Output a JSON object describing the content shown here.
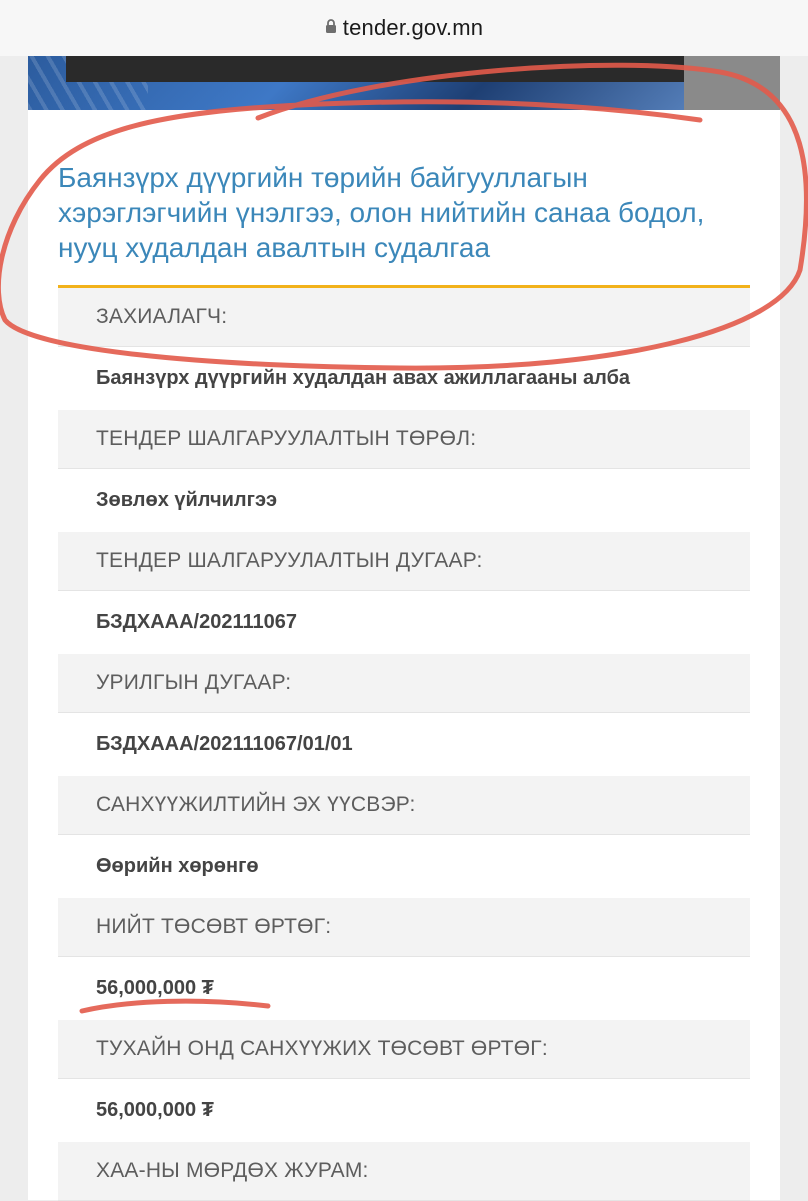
{
  "browser": {
    "url": "tender.gov.mn",
    "lock_icon": "lock-icon"
  },
  "tender": {
    "title": "Баянзүрх дүүргийн төрийн байгууллагын хэрэглэгчийн үнэлгээ, олон нийтийн санаа бодол, нууц худалдан авалтын судалгаа",
    "fields": [
      {
        "label": "ЗАХИАЛАГЧ:",
        "value": "Баянзүрх дүүргийн худалдан авах ажиллагааны алба"
      },
      {
        "label": "ТЕНДЕР ШАЛГАРУУЛАЛТЫН ТӨРӨЛ:",
        "value": "Зөвлөх үйлчилгээ"
      },
      {
        "label": "ТЕНДЕР ШАЛГАРУУЛАЛТЫН ДУГААР:",
        "value": "БЗДХААА/202111067"
      },
      {
        "label": "УРИЛГЫН ДУГААР:",
        "value": "БЗДХААА/202111067/01/01"
      },
      {
        "label": "САНХҮҮЖИЛТИЙН ЭХ ҮҮСВЭР:",
        "value": "Өөрийн хөрөнгө"
      },
      {
        "label": "НИЙТ ТӨСӨВТ ӨРТӨГ:",
        "value": "56,000,000 ₮"
      },
      {
        "label": "ТУХАЙН ОНД САНХҮҮЖИХ ТӨСӨВТ ӨРТӨГ:",
        "value": "56,000,000 ₮"
      },
      {
        "label": "ХАА-НЫ МӨРДӨХ ЖУРАМ:",
        "value": ""
      }
    ]
  },
  "colors": {
    "title": "#3b87b9",
    "title_rule": "#f2b21a",
    "annotation": "#e25a4a"
  }
}
